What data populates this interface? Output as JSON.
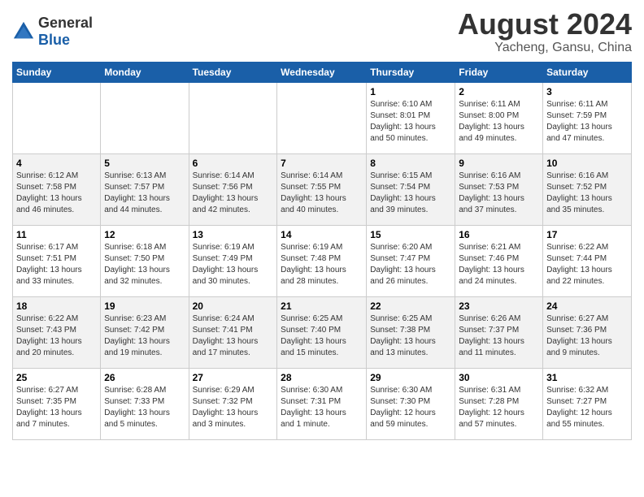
{
  "header": {
    "logo_general": "General",
    "logo_blue": "Blue",
    "month_year": "August 2024",
    "location": "Yacheng, Gansu, China"
  },
  "weekdays": [
    "Sunday",
    "Monday",
    "Tuesday",
    "Wednesday",
    "Thursday",
    "Friday",
    "Saturday"
  ],
  "weeks": [
    [
      {
        "day": "",
        "info": ""
      },
      {
        "day": "",
        "info": ""
      },
      {
        "day": "",
        "info": ""
      },
      {
        "day": "",
        "info": ""
      },
      {
        "day": "1",
        "info": "Sunrise: 6:10 AM\nSunset: 8:01 PM\nDaylight: 13 hours\nand 50 minutes."
      },
      {
        "day": "2",
        "info": "Sunrise: 6:11 AM\nSunset: 8:00 PM\nDaylight: 13 hours\nand 49 minutes."
      },
      {
        "day": "3",
        "info": "Sunrise: 6:11 AM\nSunset: 7:59 PM\nDaylight: 13 hours\nand 47 minutes."
      }
    ],
    [
      {
        "day": "4",
        "info": "Sunrise: 6:12 AM\nSunset: 7:58 PM\nDaylight: 13 hours\nand 46 minutes."
      },
      {
        "day": "5",
        "info": "Sunrise: 6:13 AM\nSunset: 7:57 PM\nDaylight: 13 hours\nand 44 minutes."
      },
      {
        "day": "6",
        "info": "Sunrise: 6:14 AM\nSunset: 7:56 PM\nDaylight: 13 hours\nand 42 minutes."
      },
      {
        "day": "7",
        "info": "Sunrise: 6:14 AM\nSunset: 7:55 PM\nDaylight: 13 hours\nand 40 minutes."
      },
      {
        "day": "8",
        "info": "Sunrise: 6:15 AM\nSunset: 7:54 PM\nDaylight: 13 hours\nand 39 minutes."
      },
      {
        "day": "9",
        "info": "Sunrise: 6:16 AM\nSunset: 7:53 PM\nDaylight: 13 hours\nand 37 minutes."
      },
      {
        "day": "10",
        "info": "Sunrise: 6:16 AM\nSunset: 7:52 PM\nDaylight: 13 hours\nand 35 minutes."
      }
    ],
    [
      {
        "day": "11",
        "info": "Sunrise: 6:17 AM\nSunset: 7:51 PM\nDaylight: 13 hours\nand 33 minutes."
      },
      {
        "day": "12",
        "info": "Sunrise: 6:18 AM\nSunset: 7:50 PM\nDaylight: 13 hours\nand 32 minutes."
      },
      {
        "day": "13",
        "info": "Sunrise: 6:19 AM\nSunset: 7:49 PM\nDaylight: 13 hours\nand 30 minutes."
      },
      {
        "day": "14",
        "info": "Sunrise: 6:19 AM\nSunset: 7:48 PM\nDaylight: 13 hours\nand 28 minutes."
      },
      {
        "day": "15",
        "info": "Sunrise: 6:20 AM\nSunset: 7:47 PM\nDaylight: 13 hours\nand 26 minutes."
      },
      {
        "day": "16",
        "info": "Sunrise: 6:21 AM\nSunset: 7:46 PM\nDaylight: 13 hours\nand 24 minutes."
      },
      {
        "day": "17",
        "info": "Sunrise: 6:22 AM\nSunset: 7:44 PM\nDaylight: 13 hours\nand 22 minutes."
      }
    ],
    [
      {
        "day": "18",
        "info": "Sunrise: 6:22 AM\nSunset: 7:43 PM\nDaylight: 13 hours\nand 20 minutes."
      },
      {
        "day": "19",
        "info": "Sunrise: 6:23 AM\nSunset: 7:42 PM\nDaylight: 13 hours\nand 19 minutes."
      },
      {
        "day": "20",
        "info": "Sunrise: 6:24 AM\nSunset: 7:41 PM\nDaylight: 13 hours\nand 17 minutes."
      },
      {
        "day": "21",
        "info": "Sunrise: 6:25 AM\nSunset: 7:40 PM\nDaylight: 13 hours\nand 15 minutes."
      },
      {
        "day": "22",
        "info": "Sunrise: 6:25 AM\nSunset: 7:38 PM\nDaylight: 13 hours\nand 13 minutes."
      },
      {
        "day": "23",
        "info": "Sunrise: 6:26 AM\nSunset: 7:37 PM\nDaylight: 13 hours\nand 11 minutes."
      },
      {
        "day": "24",
        "info": "Sunrise: 6:27 AM\nSunset: 7:36 PM\nDaylight: 13 hours\nand 9 minutes."
      }
    ],
    [
      {
        "day": "25",
        "info": "Sunrise: 6:27 AM\nSunset: 7:35 PM\nDaylight: 13 hours\nand 7 minutes."
      },
      {
        "day": "26",
        "info": "Sunrise: 6:28 AM\nSunset: 7:33 PM\nDaylight: 13 hours\nand 5 minutes."
      },
      {
        "day": "27",
        "info": "Sunrise: 6:29 AM\nSunset: 7:32 PM\nDaylight: 13 hours\nand 3 minutes."
      },
      {
        "day": "28",
        "info": "Sunrise: 6:30 AM\nSunset: 7:31 PM\nDaylight: 13 hours\nand 1 minute."
      },
      {
        "day": "29",
        "info": "Sunrise: 6:30 AM\nSunset: 7:30 PM\nDaylight: 12 hours\nand 59 minutes."
      },
      {
        "day": "30",
        "info": "Sunrise: 6:31 AM\nSunset: 7:28 PM\nDaylight: 12 hours\nand 57 minutes."
      },
      {
        "day": "31",
        "info": "Sunrise: 6:32 AM\nSunset: 7:27 PM\nDaylight: 12 hours\nand 55 minutes."
      }
    ]
  ]
}
